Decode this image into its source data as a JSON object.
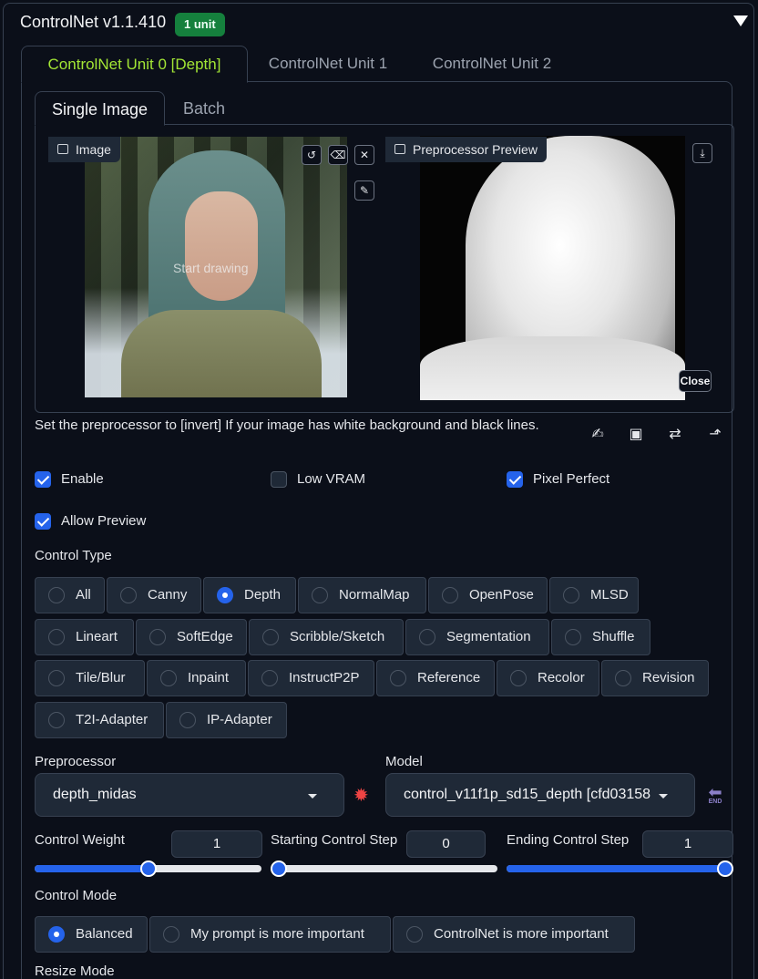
{
  "header": {
    "title": "ControlNet v1.1.410",
    "badge": "1 unit"
  },
  "unit_tabs": [
    {
      "label": "ControlNet Unit 0 [Depth]",
      "active": true
    },
    {
      "label": "ControlNet Unit 1",
      "active": false
    },
    {
      "label": "ControlNet Unit 2",
      "active": false
    }
  ],
  "image_tabs": [
    {
      "label": "Single Image",
      "active": true
    },
    {
      "label": "Batch",
      "active": false
    }
  ],
  "image_panel": {
    "label": "Image",
    "overlay_text": "Start drawing"
  },
  "preview_panel": {
    "label": "Preprocessor Preview",
    "close_label": "Close"
  },
  "hint_text": "Set the preprocessor to [invert] If your image has white background and black lines.",
  "checkboxes": {
    "enable": {
      "label": "Enable",
      "checked": true
    },
    "low_vram": {
      "label": "Low VRAM",
      "checked": false
    },
    "pixel_perfect": {
      "label": "Pixel Perfect",
      "checked": true
    },
    "allow_preview": {
      "label": "Allow Preview",
      "checked": true
    }
  },
  "control_type": {
    "label": "Control Type",
    "options": [
      "All",
      "Canny",
      "Depth",
      "NormalMap",
      "OpenPose",
      "MLSD",
      "Lineart",
      "SoftEdge",
      "Scribble/Sketch",
      "Segmentation",
      "Shuffle",
      "Tile/Blur",
      "Inpaint",
      "InstructP2P",
      "Reference",
      "Recolor",
      "Revision",
      "T2I-Adapter",
      "IP-Adapter"
    ],
    "selected": "Depth"
  },
  "preprocessor": {
    "label": "Preprocessor",
    "value": "depth_midas"
  },
  "model": {
    "label": "Model",
    "value": "control_v11f1p_sd15_depth [cfd03158"
  },
  "control_weight": {
    "label": "Control Weight",
    "value": "1",
    "fraction": 0.5
  },
  "starting_step": {
    "label": "Starting Control Step",
    "value": "0",
    "fraction": 0.0
  },
  "ending_step": {
    "label": "Ending Control Step",
    "value": "1",
    "fraction": 1.0
  },
  "control_mode": {
    "label": "Control Mode",
    "options": [
      "Balanced",
      "My prompt is more important",
      "ControlNet is more important"
    ],
    "selected": "Balanced"
  },
  "resize_mode": {
    "label": "Resize Mode"
  },
  "colors": {
    "accent": "#2563eb",
    "active_tab": "#a3e635",
    "badge": "#15803d",
    "background": "#0b0f19"
  }
}
